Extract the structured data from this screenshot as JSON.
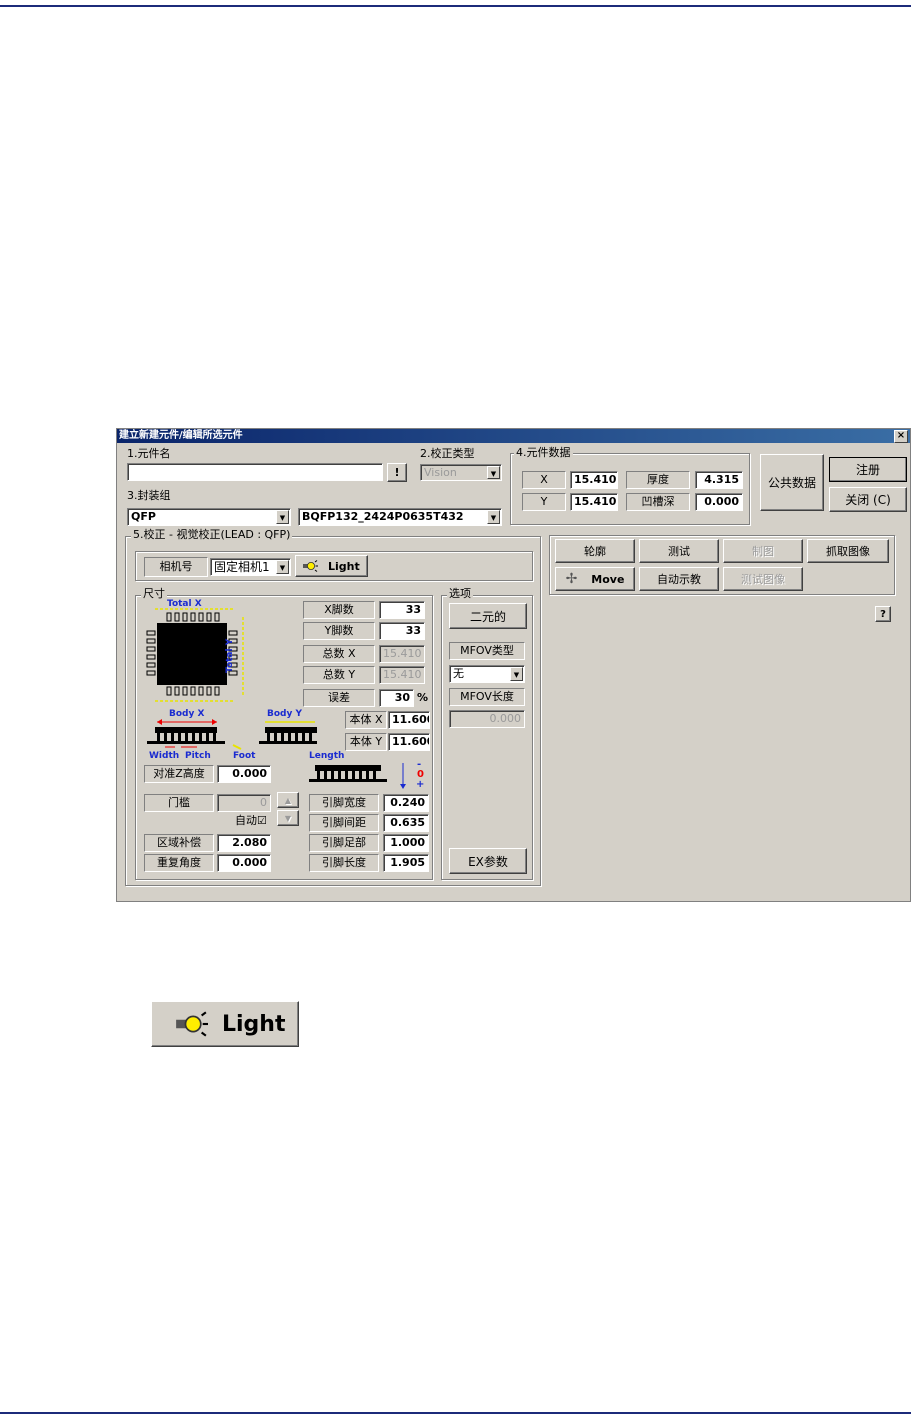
{
  "page": {
    "rule_color": "#1c2b7a"
  },
  "dialog": {
    "title": "建立新建元件/编辑所选元件",
    "close_glyph": "×",
    "sec1": {
      "label": "1.元件名",
      "name_value": "",
      "btn": "!"
    },
    "sec2": {
      "label": "2.校正类型",
      "value": "Vision"
    },
    "sec3": {
      "label": "3.封装组",
      "group_value": "QFP",
      "package_value": "BQFP132_2424P0635T432"
    },
    "sec4": {
      "label": "4.元件数据",
      "x_label": "X",
      "x_value": "15.410",
      "y_label": "Y",
      "y_value": "15.410",
      "thick_label": "厚度",
      "thick_value": "4.315",
      "groove_label": "凹槽深",
      "groove_value": "0.000"
    },
    "buttons": {
      "public": "公共数据",
      "register": "注册",
      "close": "关闭 (C)"
    },
    "sec5": {
      "title": "5.校正 - 视觉校正(LEAD : QFP)",
      "camera_label": "相机号",
      "camera_value": "固定相机1",
      "light": "Light",
      "size_title": "尺寸",
      "labels": {
        "total_x": "Total X",
        "total_y": "Total Y",
        "body_x": "Body X",
        "body_y": "Body Y",
        "width": "Width",
        "pitch": "Pitch",
        "foot": "Foot",
        "length": "Length"
      },
      "x_pins_label": "X脚数",
      "x_pins": "33",
      "y_pins_label": "Y脚数",
      "y_pins": "33",
      "total_x_label": "总数 X",
      "total_x_value": "15.410",
      "total_y_label": "总数 Y",
      "total_y_value": "15.410",
      "tol_label": "误差",
      "tol_value": "30",
      "tol_unit": "%",
      "body_x_label": "本体 X",
      "body_x_value": "11.600",
      "body_y_label": "本体 Y",
      "body_y_value": "11.600",
      "z_label": "对准Z高度",
      "z_value": "0.000",
      "thresh_label": "门槛",
      "thresh_value": "0",
      "auto_label": "自动☑",
      "area_label": "区域补偿",
      "area_value": "2.080",
      "rep_label": "重复角度",
      "rep_value": "0.000",
      "lw_label": "引脚宽度",
      "lw_value": "0.240",
      "lp_label": "引脚间距",
      "lp_value": "0.635",
      "lf_label": "引脚足部",
      "lf_value": "1.000",
      "ll_label": "引脚长度",
      "ll_value": "1.905",
      "minus": "-",
      "zero": "0",
      "plus": "+",
      "options_title": "选项",
      "binary": "二元的",
      "mfov_type_label": "MFOV类型",
      "mfov_type_value": "无",
      "mfov_len_label": "MFOV长度",
      "mfov_len_value": "0.000",
      "ex": "EX参数"
    },
    "right": {
      "outline": "轮廓",
      "test": "测试",
      "make": "制图",
      "capture": "抓取图像",
      "move": "Move",
      "auto_teach": "自动示教",
      "test_image": "测试图像",
      "help": "?"
    }
  },
  "zoom_light": {
    "label": "Light",
    "icon": "lightbulb-icon"
  }
}
